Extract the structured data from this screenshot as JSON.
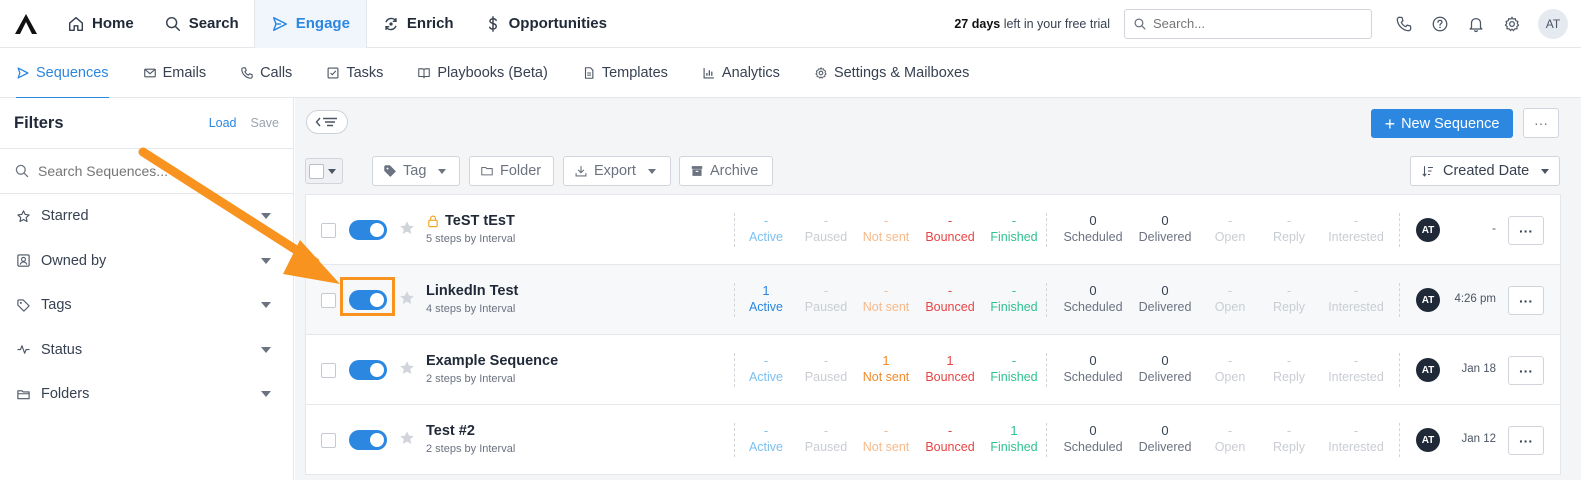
{
  "topbar": {
    "nav": [
      {
        "label": "Home",
        "icon": "home-icon"
      },
      {
        "label": "Search",
        "icon": "search-icon"
      },
      {
        "label": "Engage",
        "icon": "send-icon",
        "active": true
      },
      {
        "label": "Enrich",
        "icon": "refresh-icon"
      },
      {
        "label": "Opportunities",
        "icon": "dollar-icon"
      }
    ],
    "trial_days": "27 days",
    "trial_text": " left in your free trial",
    "search_placeholder": "Search...",
    "avatar": "AT"
  },
  "subnav": [
    {
      "label": "Sequences",
      "active": true
    },
    {
      "label": "Emails"
    },
    {
      "label": "Calls"
    },
    {
      "label": "Tasks"
    },
    {
      "label": "Playbooks (Beta)"
    },
    {
      "label": "Templates"
    },
    {
      "label": "Analytics"
    },
    {
      "label": "Settings & Mailboxes"
    }
  ],
  "sidebar": {
    "title": "Filters",
    "load": "Load",
    "save": "Save",
    "search_placeholder": "Search Sequences...",
    "filters": [
      "Starred",
      "Owned by",
      "Tags",
      "Status",
      "Folders"
    ]
  },
  "toolbar": {
    "new_sequence": "New Sequence",
    "more": "···",
    "tag": "Tag",
    "folder": "Folder",
    "export": "Export",
    "archive": "Archive",
    "sort": "Created Date"
  },
  "stat_labels": {
    "active": "Active",
    "paused": "Paused",
    "not_sent": "Not sent",
    "bounced": "Bounced",
    "finished": "Finished",
    "scheduled": "Scheduled",
    "delivered": "Delivered",
    "open": "Open",
    "reply": "Reply",
    "interested": "Interested"
  },
  "sequences": [
    {
      "name": "TeST tEsT",
      "locked": true,
      "sub": "5 steps by Interval",
      "active": "-",
      "paused": "-",
      "not_sent": "-",
      "bounced": "-",
      "finished": "-",
      "scheduled": "0",
      "delivered": "0",
      "open": "-",
      "reply": "-",
      "interested": "-",
      "owner": "AT",
      "date": "-",
      "more": "···"
    },
    {
      "name": "LinkedIn Test",
      "locked": false,
      "sub": "4 steps by Interval",
      "active": "1",
      "paused": "-",
      "not_sent": "-",
      "bounced": "-",
      "finished": "-",
      "scheduled": "0",
      "delivered": "0",
      "open": "-",
      "reply": "-",
      "interested": "-",
      "owner": "AT",
      "date": "4:26 pm",
      "more": "···"
    },
    {
      "name": "Example Sequence",
      "locked": false,
      "sub": "2 steps by Interval",
      "active": "-",
      "paused": "-",
      "not_sent": "1",
      "bounced": "1",
      "finished": "-",
      "scheduled": "0",
      "delivered": "0",
      "open": "-",
      "reply": "-",
      "interested": "-",
      "owner": "AT",
      "date": "Jan 18",
      "more": "···"
    },
    {
      "name": "Test #2",
      "locked": false,
      "sub": "2 steps by Interval",
      "active": "-",
      "paused": "-",
      "not_sent": "-",
      "bounced": "-",
      "finished": "1",
      "scheduled": "0",
      "delivered": "0",
      "open": "-",
      "reply": "-",
      "interested": "-",
      "owner": "AT",
      "date": "Jan 12",
      "more": "···"
    }
  ],
  "colors": {
    "accent": "#2b87e0",
    "annotation": "#f7931e"
  }
}
